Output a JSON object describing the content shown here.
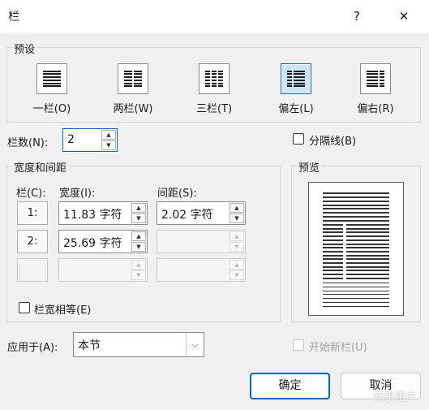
{
  "window": {
    "title": "栏",
    "help": "?",
    "close": "✕"
  },
  "presets": {
    "label": "预设",
    "items": [
      {
        "label": "一栏(O)",
        "cols": 1,
        "selected": false
      },
      {
        "label": "两栏(W)",
        "cols": 2,
        "selected": false
      },
      {
        "label": "三栏(T)",
        "cols": 3,
        "selected": false
      },
      {
        "label": "偏左(L)",
        "cols": 2,
        "selected": true
      },
      {
        "label": "偏右(R)",
        "cols": 2,
        "selected": false
      }
    ]
  },
  "num_columns": {
    "label": "栏数(N):",
    "value": "2"
  },
  "separator": {
    "label": "分隔线(B)",
    "checked": false
  },
  "width_spacing": {
    "label": "宽度和间距",
    "col_header": "栏(C):",
    "width_header": "宽度(I):",
    "spacing_header": "间距(S):",
    "rows": [
      {
        "col": "1:",
        "width": "11.83 字符",
        "spacing": "2.02 字符"
      },
      {
        "col": "2:",
        "width": "25.69 字符",
        "spacing": ""
      },
      {
        "col": "",
        "width": "",
        "spacing": ""
      }
    ],
    "equal_width": {
      "label": "栏宽相等(E)",
      "checked": false
    }
  },
  "preview": {
    "label": "预览"
  },
  "apply_to": {
    "label": "应用于(A):",
    "value": "本节"
  },
  "new_column": {
    "label": "开始新栏(U)",
    "checked": false
  },
  "buttons": {
    "ok": "确定",
    "cancel": "取消"
  },
  "watermark": "知乎用户"
}
